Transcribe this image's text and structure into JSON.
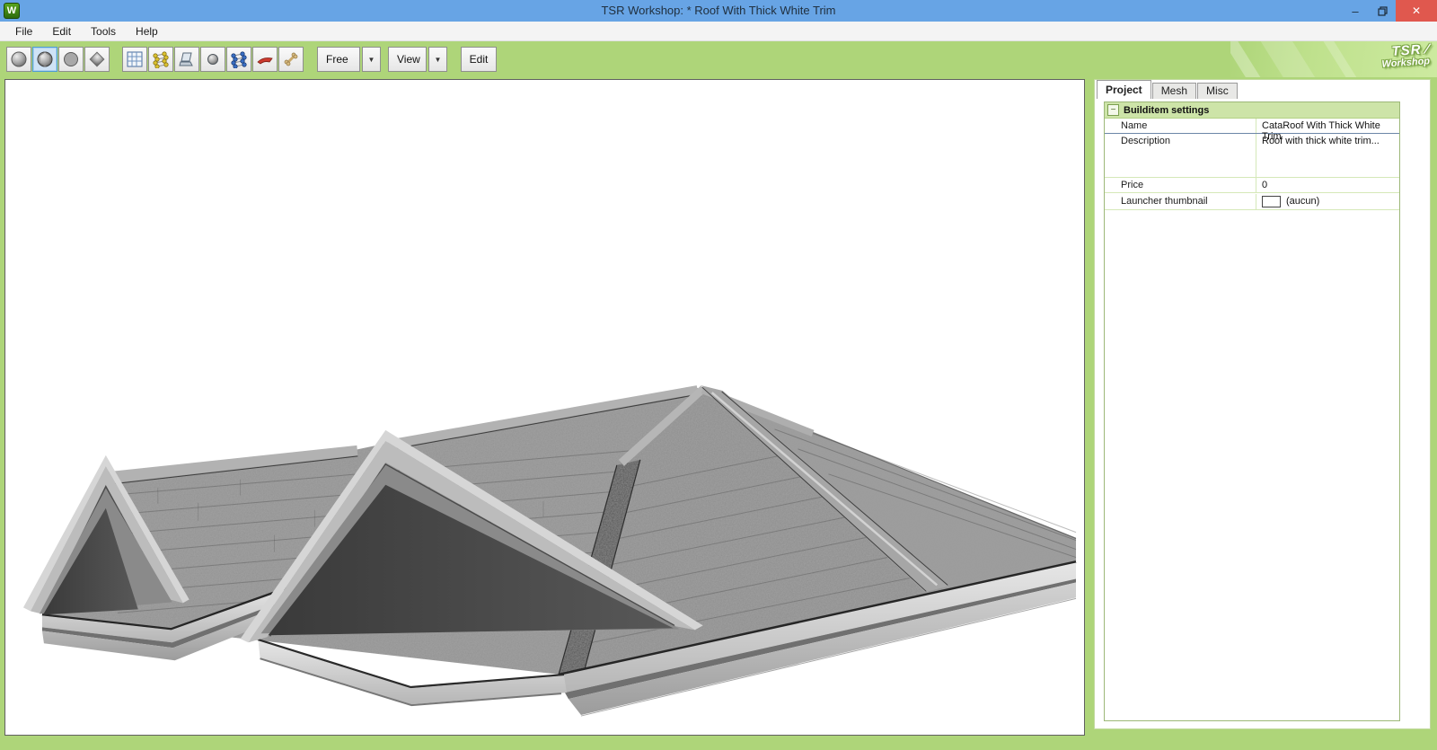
{
  "window": {
    "title": "TSR Workshop: * Roof With Thick White Trim",
    "app_icon_letter": "W",
    "controls": {
      "minimize_glyph": "–",
      "close_glyph": "✕"
    }
  },
  "menu": {
    "items": [
      "File",
      "Edit",
      "Tools",
      "Help"
    ]
  },
  "toolbar": {
    "icons": [
      "sphere-smooth",
      "sphere-shaded-selected",
      "sphere-flat",
      "diamond",
      "grid",
      "lattice-yellow",
      "laptop",
      "small-sphere",
      "lattice-blue",
      "roof-piece-red",
      "bone"
    ],
    "free_dropdown_value": "Free",
    "view_dropdown_value": "View",
    "edit_button_label": "Edit",
    "dropdown_arrow_glyph": "▼",
    "logo_line1": "TSR ∕",
    "logo_line2": "Workshop"
  },
  "panel": {
    "tabs": [
      {
        "label": "Project",
        "active": true
      },
      {
        "label": "Mesh",
        "active": false
      },
      {
        "label": "Misc",
        "active": false
      }
    ],
    "settings": {
      "collapse_glyph": "−",
      "header": "Builditem settings",
      "rows": [
        {
          "label": "Name",
          "value": "CataRoof With Thick White Trim"
        },
        {
          "label": "Description",
          "value": "Roof with thick white trim..."
        },
        {
          "label": "Price",
          "value": "0"
        },
        {
          "label": "Launcher thumbnail",
          "value": "(aucun)"
        }
      ]
    }
  },
  "colors": {
    "titlebar_blue": "#67a4e5",
    "toolbar_green": "#aed579",
    "close_red": "#e0584e",
    "selection_blue": "#cfe3f6",
    "grid_header_green": "#cde4a8"
  }
}
